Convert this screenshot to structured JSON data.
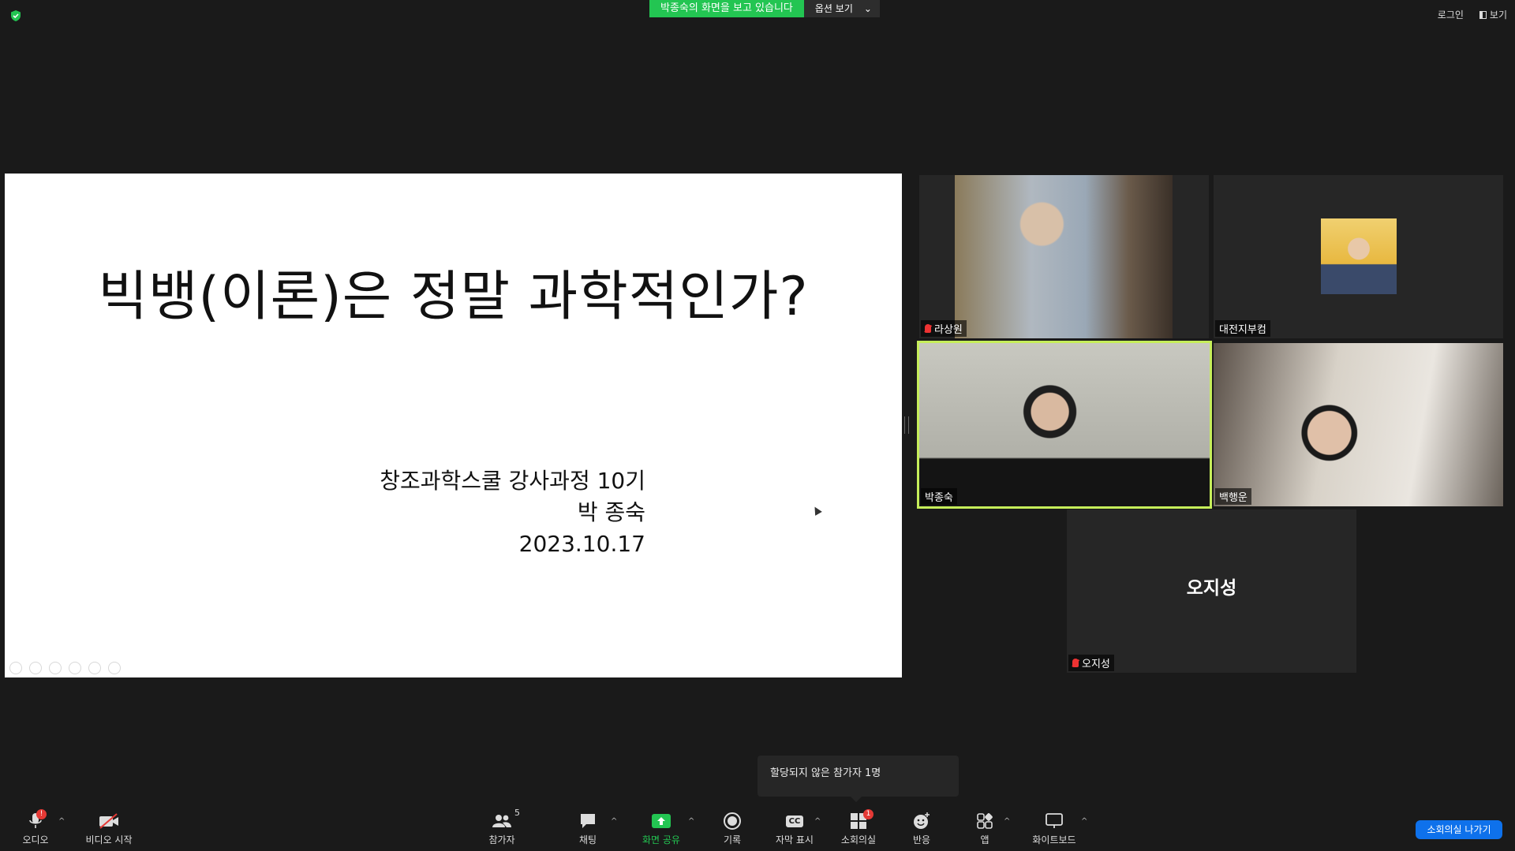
{
  "topbar": {
    "share_banner": "박종숙의 화면을 보고 있습니다",
    "view_options": "옵션 보기",
    "login": "로그인",
    "view": "보기"
  },
  "slide": {
    "title": "빅뱅(이론)은 정말 과학적인가?",
    "course": "창조과학스쿨 강사과정 10기",
    "author": "박 종숙",
    "date": "2023.10.17"
  },
  "participants_tiles": [
    {
      "name": "라상원",
      "muted": true
    },
    {
      "name": "대전지부컴",
      "muted": false
    },
    {
      "name": "박종숙",
      "muted": false,
      "active_speaker": true
    },
    {
      "name": "백행운",
      "muted": false
    },
    {
      "name": "오지성",
      "muted": true,
      "video_off": true
    }
  ],
  "popup": {
    "text": "할당되지 않은 참가자 1명"
  },
  "toolbar": {
    "audio": "오디오",
    "video": "비디오 시작",
    "participants": "참가자",
    "participants_count": "5",
    "chat": "채팅",
    "share": "화면 공유",
    "record": "기록",
    "captions": "자막 표시",
    "captions_icon": "CC",
    "breakout": "소회의실",
    "breakout_badge": "1",
    "reactions": "반응",
    "apps": "앱",
    "whiteboard": "화이트보드",
    "leave_breakout": "소회의실 나가기"
  },
  "colors": {
    "share_green": "#23c552",
    "speaker_border": "#c6ee5a",
    "leave_blue": "#0e71eb",
    "alert_red": "#e53935"
  }
}
